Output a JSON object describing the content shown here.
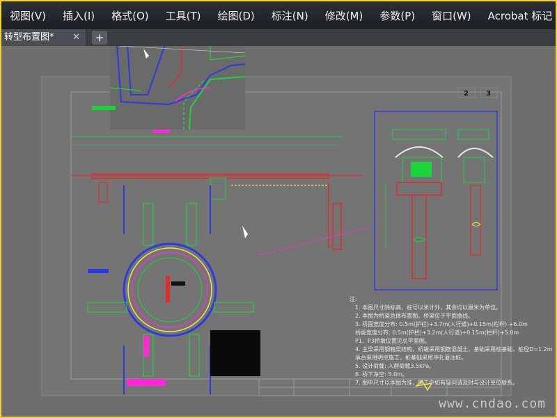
{
  "menu": {
    "items": [
      "视图(V)",
      "插入(I)",
      "格式(O)",
      "工具(T)",
      "绘图(D)",
      "标注(N)",
      "修改(M)",
      "参数(P)",
      "窗口(W)",
      "Acrobat 标记"
    ]
  },
  "tab": {
    "title": "转型布置图*",
    "close_symbol": "✕",
    "new_symbol": "+"
  },
  "drawing": {
    "page_numbers": [
      "2",
      "3"
    ],
    "notes_title": "注:",
    "notes": [
      "1. 本图尺寸除标高、桩号以米计外，其余均以厘米为单位。",
      "2. 本图为桥梁总体布置图，桥梁位于平面曲线。",
      "3. 桥面宽度分布: 0.5m(护栏)+3.7m(人行道)+0.15m(栏杆) +6.0m",
      "   桥面宽度分布: 0.5m(护栏)+3.2m(人行道)+0.15m(栏杆)+5.0m",
      "   P1、P3桥墩位置见总平面图。",
      "4. 主梁采用钢箱梁结构，桥墩采用钢筋混凝土，基础采用桩基础，桩径D=1.2m",
      "   承台采用明挖施工，桩基础采用冲孔灌注桩。",
      "5. 设计荷载: 人群荷载3.5kPa。",
      "6. 桥下净空: 5.0m。",
      "7. 图中尺寸以本图为准，施工中如有疑问请及时与设计单位联系。"
    ]
  },
  "watermark": "www.cndao.com",
  "colors": {
    "frame_border": "#f2d23a",
    "menubar": "#23262b",
    "canvas": "#6e6e6e"
  }
}
